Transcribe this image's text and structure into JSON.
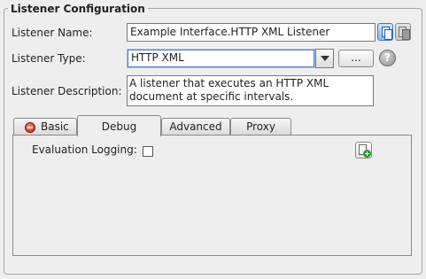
{
  "section": {
    "title": "Listener Configuration"
  },
  "fields": {
    "name_label": "Listener Name:",
    "name_value": "Example Interface.HTTP XML Listener",
    "type_label": "Listener Type:",
    "type_value": "HTTP XML",
    "type_browse_label": "...",
    "help_glyph": "?",
    "description_label": "Listener Description:",
    "description_value": "A listener that executes an HTTP XML document at specific intervals."
  },
  "tabs": [
    {
      "label": "Basic",
      "active": false,
      "has_error": true
    },
    {
      "label": "Debug",
      "active": true,
      "has_error": false
    },
    {
      "label": "Advanced",
      "active": false,
      "has_error": false
    },
    {
      "label": "Proxy",
      "active": false,
      "has_error": false
    }
  ],
  "debug": {
    "evaluation_logging_label": "Evaluation Logging:",
    "evaluation_logging_checked": false
  },
  "icons": {
    "copy": "copy-icon",
    "paste": "paste-icon",
    "help": "help-icon",
    "error": "error-icon",
    "add": "add-document-icon"
  },
  "colors": {
    "background": "#eeeeee",
    "select_focus": "#4a7fc8",
    "error": "#d01a0a",
    "add_green": "#2f9a2f"
  }
}
